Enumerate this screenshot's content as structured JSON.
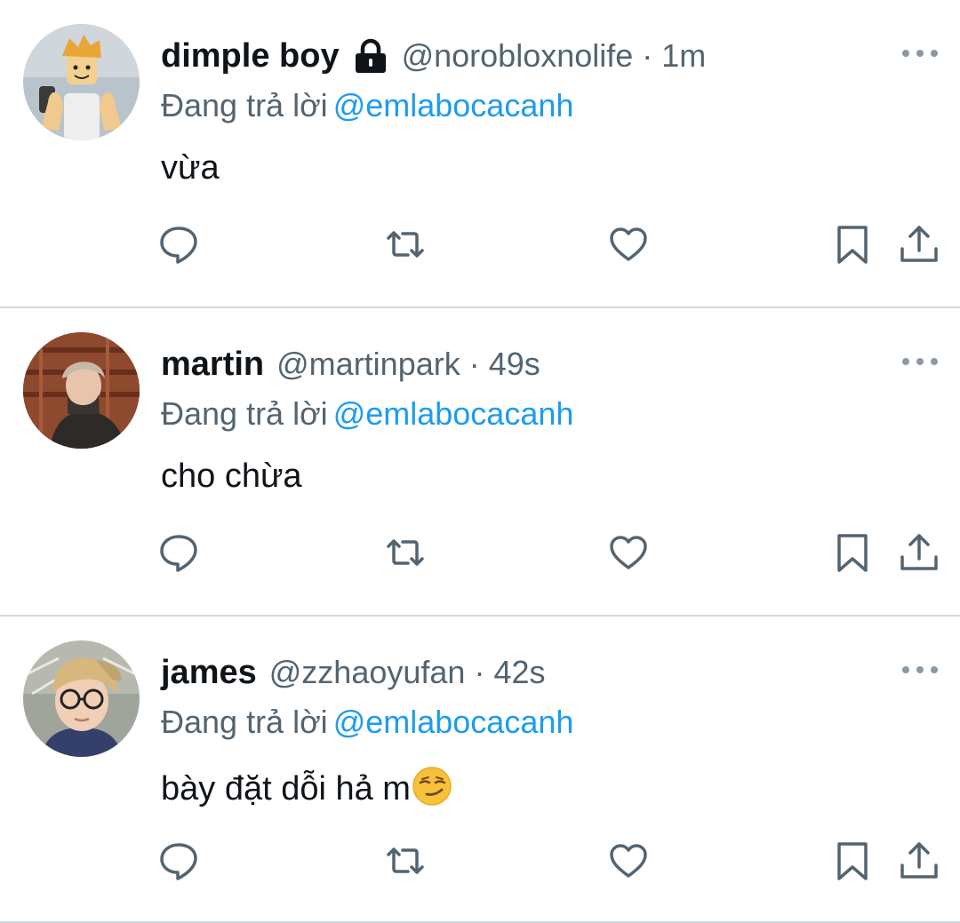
{
  "tweets": [
    {
      "name": "dimple boy",
      "locked": true,
      "handle": "@norobloxnolife",
      "separator": "·",
      "time": "1m",
      "replying_label": "Đang trả lời",
      "replying_to": "@emlabocacanh",
      "text": "vừa"
    },
    {
      "name": "martin",
      "locked": false,
      "handle": "@martinpark",
      "separator": "·",
      "time": "49s",
      "replying_label": "Đang trả lời",
      "replying_to": "@emlabocacanh",
      "text": "cho chừa"
    },
    {
      "name": "james",
      "locked": false,
      "handle": "@zzhaoyufan",
      "separator": "·",
      "time": "42s",
      "replying_label": "Đang trả lời",
      "replying_to": "@emlabocacanh",
      "text": "bày đặt dỗi hả m",
      "emoji": "smirking-face"
    }
  ],
  "icons": {
    "reply": "reply-icon",
    "retweet": "retweet-icon",
    "like": "heart-icon",
    "bookmark": "bookmark-icon",
    "share": "share-icon",
    "more": "more-icon",
    "lock": "lock-icon"
  },
  "colors": {
    "text": "#0f1419",
    "secondary": "#536471",
    "accent": "#1d9bf0",
    "divider": "#cfd9de"
  }
}
